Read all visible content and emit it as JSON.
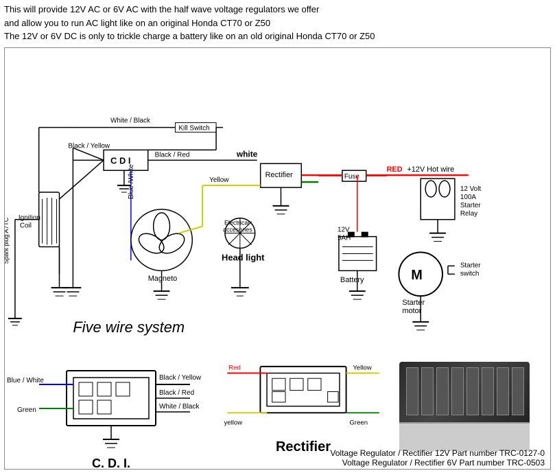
{
  "header": {
    "line1": "This will provide 12V AC or 6V AC with the half wave voltage regulators we offer",
    "line2": "and allow you to run AC light like on an original Honda CT70 or Z50",
    "line3": "The 12V or 6V DC is only to trickle charge a battery like on an old original Honda CT70 or Z50"
  },
  "diagram": {
    "title": "Five wire system",
    "labels": {
      "killSwitch": "Kill Switch",
      "whiteBlack": "White / Black",
      "blackYellow": "Black / Yellow",
      "cdi": "C D I",
      "blackRed": "Black / Red",
      "white": "white",
      "rectifier": "Rectifier",
      "red": "RED",
      "hotWire": "+12V Hot wire",
      "yellow": "Yellow",
      "fuse": "Fuse",
      "twelveVolt": "12 Volt",
      "starterRelayLabel": "100A\nStarter\nRelay",
      "blueWhite": "Blue /White",
      "ignitionCoil": "Ignition\nCoil",
      "magneto": "Magneto",
      "electricalAcc": "Electrical\naccesories",
      "headLight": "Head light",
      "battery": "Battery",
      "batterySpec": "12V\n5AH",
      "starterMotor": "Starter\nmotor",
      "starterSwitch": "Starter\nswitch",
      "sparkPlug": "Spark plug A7TC"
    }
  },
  "cdi": {
    "title": "C. D. I.",
    "labels": {
      "blueWhite": "Blue / White",
      "blackYellow": "Black / Yellow",
      "blackRed": "Black / Red",
      "whiteBlack": "White / Black",
      "green": "Green"
    }
  },
  "rectifier": {
    "title": "Rectifier",
    "labels": {
      "red": "Red",
      "yellow": "Yellow",
      "green": "Green",
      "yellowBottom": "yellow"
    }
  },
  "partNumbers": {
    "line1": "Voltage Regulator / Rectifier 12V Part number TRC-0127-0",
    "line2": "Voltage Regulator / Rectifier 6V Part number TRC-0503"
  }
}
